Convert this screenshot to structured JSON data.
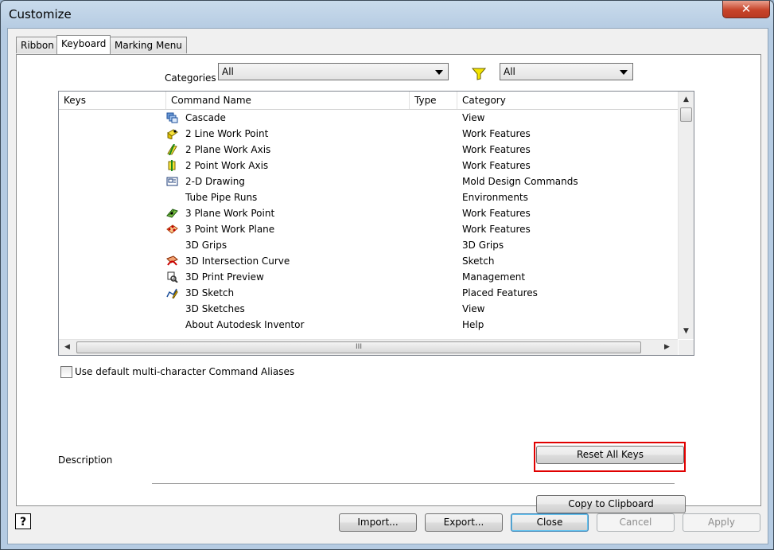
{
  "window": {
    "title": "Customize",
    "close_glyph": "✕"
  },
  "tabs": [
    {
      "label": "Ribbon",
      "active": false
    },
    {
      "label": "Keyboard",
      "active": true
    },
    {
      "label": "Marking Menu",
      "active": false
    }
  ],
  "filters": {
    "categories_label": "Categories",
    "categories_value": "All",
    "filter_icon": "funnel-icon",
    "filter_value": "All"
  },
  "table": {
    "columns": [
      "Keys",
      "Command Name",
      "Type",
      "Category"
    ],
    "rows": [
      {
        "keys": "",
        "icon": "cascade-icon",
        "command": "Cascade",
        "type": "",
        "category": "View"
      },
      {
        "keys": "",
        "icon": "line-work-point-icon",
        "command": "2 Line Work Point",
        "type": "",
        "category": "Work Features"
      },
      {
        "keys": "",
        "icon": "plane-work-axis-icon",
        "command": "2 Plane Work Axis",
        "type": "",
        "category": "Work Features"
      },
      {
        "keys": "",
        "icon": "point-work-axis-icon",
        "command": "2 Point Work Axis",
        "type": "",
        "category": "Work Features"
      },
      {
        "keys": "",
        "icon": "drawing-icon",
        "command": "2-D Drawing",
        "type": "",
        "category": "Mold Design Commands"
      },
      {
        "keys": "",
        "icon": "",
        "command": "Tube  Pipe Runs",
        "type": "",
        "category": "Environments"
      },
      {
        "keys": "",
        "icon": "plane-work-point-icon",
        "command": "3 Plane Work Point",
        "type": "",
        "category": "Work Features"
      },
      {
        "keys": "",
        "icon": "point-work-plane-icon",
        "command": "3 Point Work Plane",
        "type": "",
        "category": "Work Features"
      },
      {
        "keys": "",
        "icon": "",
        "command": "3D Grips",
        "type": "",
        "category": "3D Grips"
      },
      {
        "keys": "",
        "icon": "intersection-curve-icon",
        "command": "3D Intersection Curve",
        "type": "",
        "category": "Sketch"
      },
      {
        "keys": "",
        "icon": "print-preview-icon",
        "command": "3D Print Preview",
        "type": "",
        "category": "Management"
      },
      {
        "keys": "",
        "icon": "sketch-3d-icon",
        "command": "3D Sketch",
        "type": "",
        "category": "Placed Features"
      },
      {
        "keys": "",
        "icon": "",
        "command": "3D Sketches",
        "type": "",
        "category": "View"
      },
      {
        "keys": "",
        "icon": "",
        "command": "About Autodesk Inventor",
        "type": "",
        "category": "Help"
      }
    ],
    "hscroll_grip": "III"
  },
  "options": {
    "aliases_checkbox_label": "Use default multi-character Command Aliases",
    "aliases_checked": false
  },
  "buttons": {
    "reset_all_keys": "Reset All Keys",
    "copy_to_clipboard": "Copy to Clipboard",
    "import": "Import...",
    "export": "Export...",
    "close": "Close",
    "cancel": "Cancel",
    "apply": "Apply"
  },
  "description_label": "Description",
  "help_glyph": "?",
  "colors": {
    "highlight_border": "#e00000",
    "title_gradient": "#b5cbe2",
    "close_red": "#c7432a"
  }
}
